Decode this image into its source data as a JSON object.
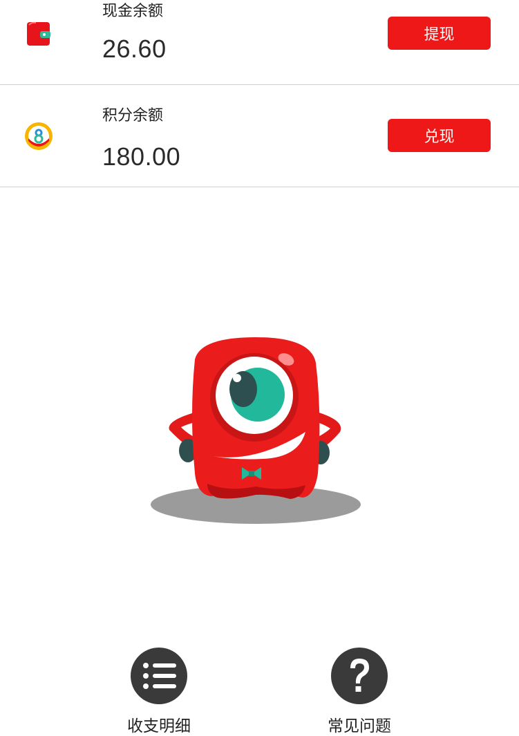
{
  "balances": {
    "cash": {
      "label": "现金余额",
      "amount": "26.60",
      "button_label": "提现",
      "icon": "wallet-icon"
    },
    "points": {
      "label": "积分余额",
      "amount": "180.00",
      "button_label": "兑现",
      "icon": "points-coin-icon"
    }
  },
  "bottom_nav": {
    "details": {
      "label": "收支明细",
      "icon": "list-icon"
    },
    "faq": {
      "label": "常见问题",
      "icon": "question-icon"
    }
  },
  "colors": {
    "accent": "#ef1818",
    "nav_icon_bg": "#3a3a3a",
    "divider": "#cfcfcf"
  }
}
